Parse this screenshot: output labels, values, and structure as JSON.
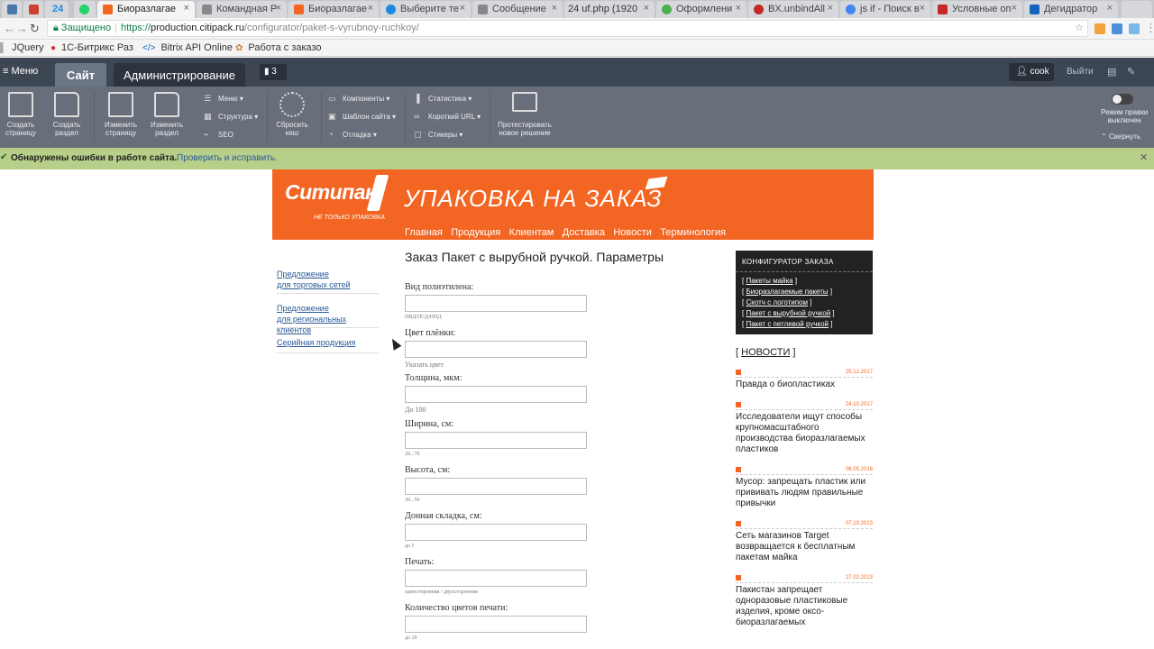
{
  "browser": {
    "tabs": [
      {
        "label": "",
        "fav": "#4a76a8"
      },
      {
        "label": "",
        "fav": "#d23f31"
      },
      {
        "label": "24",
        "fav": "#1e88e5"
      },
      {
        "label": "",
        "fav": "#25d366"
      },
      {
        "label": "Биоразлагае",
        "fav": "#f26522"
      },
      {
        "label": "Командная Р",
        "fav": "#888888"
      },
      {
        "label": "Биоразлагае",
        "fav": "#f26522"
      },
      {
        "label": "Выберите те",
        "fav": "#1e88e5"
      },
      {
        "label": "Сообщение",
        "fav": "#888888"
      },
      {
        "label": "24  uf.php (1920",
        "fav": "#1e88e5"
      },
      {
        "label": "Оформлени",
        "fav": "#4caf50"
      },
      {
        "label": "BX.unbindAll",
        "fav": "#c62828"
      },
      {
        "label": "js if - Поиск в",
        "fav": "#4285f4"
      },
      {
        "label": "Условные оп",
        "fav": "#c62828"
      },
      {
        "label": "Дегидратор",
        "fav": "#1565c0"
      }
    ],
    "secure_label": "Защищено",
    "url_scheme": "https://",
    "url_host": "production.citipack.ru",
    "url_path": "/configurator/paket-s-vyrubnoy-ruchkoy/",
    "bookmarks": [
      "JQuery",
      "1С-Битрикс Раз",
      "Bitrix API Online",
      "Работа с заказо"
    ]
  },
  "bitrix": {
    "menu_label": "Меню",
    "tab_site": "Сайт",
    "tab_admin": "Администрирование",
    "badge": "3",
    "user": "cook",
    "exit": "Выйти",
    "tools": {
      "create_page": [
        "Создать",
        "страницу"
      ],
      "create_section": [
        "Создать",
        "раздел"
      ],
      "edit_page": [
        "Изменить",
        "страницу"
      ],
      "edit_section": [
        "Изменить",
        "раздел"
      ],
      "reset_cache": [
        "Сбросить",
        "кеш"
      ],
      "test_solution": [
        "Протестировать",
        "новое решение"
      ],
      "menu": "Меню",
      "structure": "Структура",
      "seo": "SEO",
      "components": "Компоненты",
      "template": "Шаблон сайта",
      "debug": "Отладка",
      "stats": "Статистика",
      "short_url": "Короткий URL",
      "stickers": "Стикеры",
      "edit_mode": [
        "Режим правки",
        "выключен"
      ],
      "collapse": "Свернуть"
    }
  },
  "errorbar": {
    "message": "Обнаружены ошибки в работе сайта.",
    "link": "Проверить и исправить."
  },
  "site": {
    "logo": "Ситипак",
    "logo_tag": "НЕ ТОЛЬКО УПАКОВКА",
    "slogan": "УПАКОВКА НА ЗАКАЗ",
    "nav": [
      "Главная",
      "Продукция",
      "Клиентам",
      "Доставка",
      "Новости",
      "Терминология"
    ],
    "leftnav": [
      [
        "Предложение",
        "для торговых сетей"
      ],
      [
        "Предложение",
        "для региональных клиентов"
      ],
      [
        "Серийная продукция"
      ]
    ],
    "page_title": "Заказ Пакет с вырубной ручкой. Параметры",
    "fields": [
      {
        "label": "Вид полиэтилена:",
        "hint": "ПВД/ПСД/ПНД"
      },
      {
        "label": "Цвет плёнки:",
        "hint": "Указать цвет"
      },
      {
        "label": "Толщина, мкм:",
        "hint": "До 100"
      },
      {
        "label": "Ширина, см:",
        "hint": "20...70"
      },
      {
        "label": "Высота, см:",
        "hint": "30...50"
      },
      {
        "label": "Донная складка, см:",
        "hint": "до 5"
      },
      {
        "label": "Печать:",
        "hint": "односторонняя / двухсторонняя"
      },
      {
        "label": "Количество цветов печати:",
        "hint": "до 10"
      }
    ],
    "config": {
      "title": "КОНФИГУРАТОР ЗАКАЗА",
      "links": [
        "Пакеты майка",
        "Биоразлагаемые пакеты",
        "Скотч с логотипом",
        "Пакет с вырубной ручкой",
        "Пакет с петлевой ручкой"
      ]
    },
    "news_title": "НОВОСТИ",
    "news": [
      {
        "date": "25.12.2017",
        "title": "Правда о биопластиках"
      },
      {
        "date": "24.10.2017",
        "title": "Исследователи ищут способы крупномасштабного производства биоразлагаемых пластиков"
      },
      {
        "date": "06.05.2016",
        "title": "Мусор: запрещать пластик или прививать людям правильные привычки"
      },
      {
        "date": "07.10.2013",
        "title": "Сеть магазинов Target возвращается к бесплатным пакетам майка"
      },
      {
        "date": "27.02.2013",
        "title": "Пакистан запрещает одноразовые пластиковые изделия, кроме оксо-биоразлагаемых"
      }
    ]
  }
}
